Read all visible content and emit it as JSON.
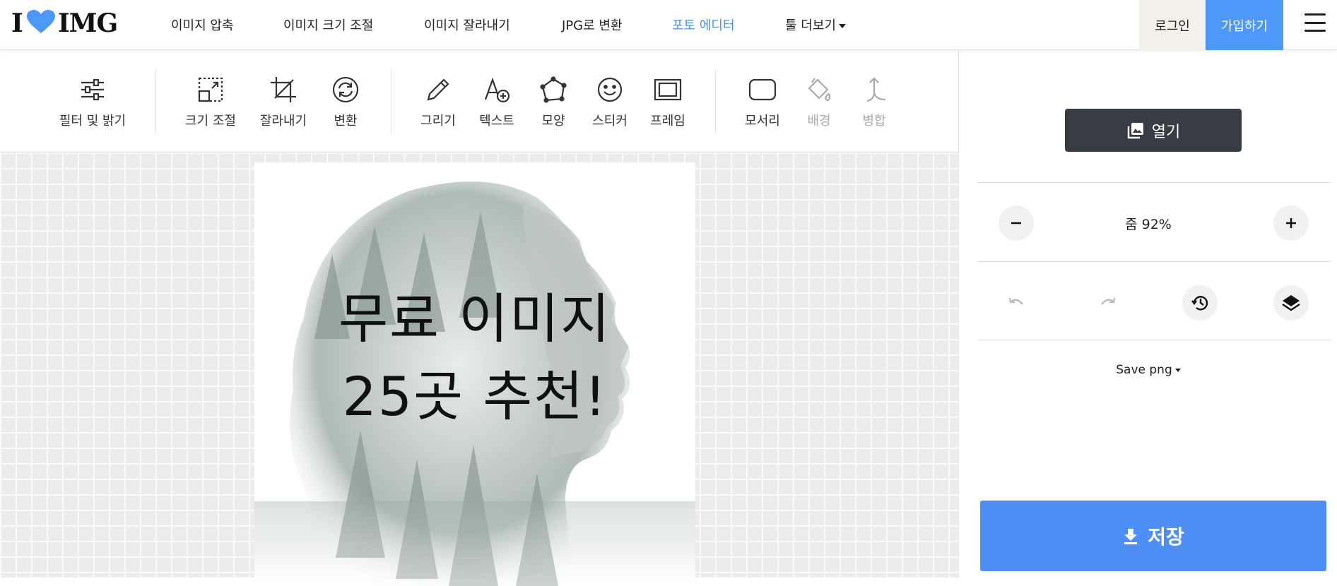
{
  "header": {
    "logo_left": "I",
    "logo_right": "IMG",
    "nav": [
      {
        "label": "이미지 압축"
      },
      {
        "label": "이미지 크기 조절"
      },
      {
        "label": "이미지 잘라내기"
      },
      {
        "label": "JPG로 변환"
      },
      {
        "label": "포토 에디터",
        "active": true
      },
      {
        "label": "툴 더보기"
      }
    ],
    "login": "로그인",
    "signup": "가입하기"
  },
  "toolbar": {
    "filters": "필터 및 밝기",
    "resize": "크기 조절",
    "crop": "잘라내기",
    "transform": "변환",
    "draw": "그리기",
    "text": "텍스트",
    "shape": "모양",
    "sticker": "스티커",
    "frame": "프레임",
    "corners": "모서리",
    "background": "배경",
    "merge": "병합"
  },
  "canvas": {
    "line1": "무료 이미지",
    "line2": "25곳 추천!"
  },
  "panel": {
    "open": "열기",
    "zoom": "줌  92%",
    "save_format": "Save png",
    "save": "저장"
  },
  "colors": {
    "accent": "#4d97f6",
    "dark_button": "#383c43",
    "active_nav": "#4a90e2"
  }
}
